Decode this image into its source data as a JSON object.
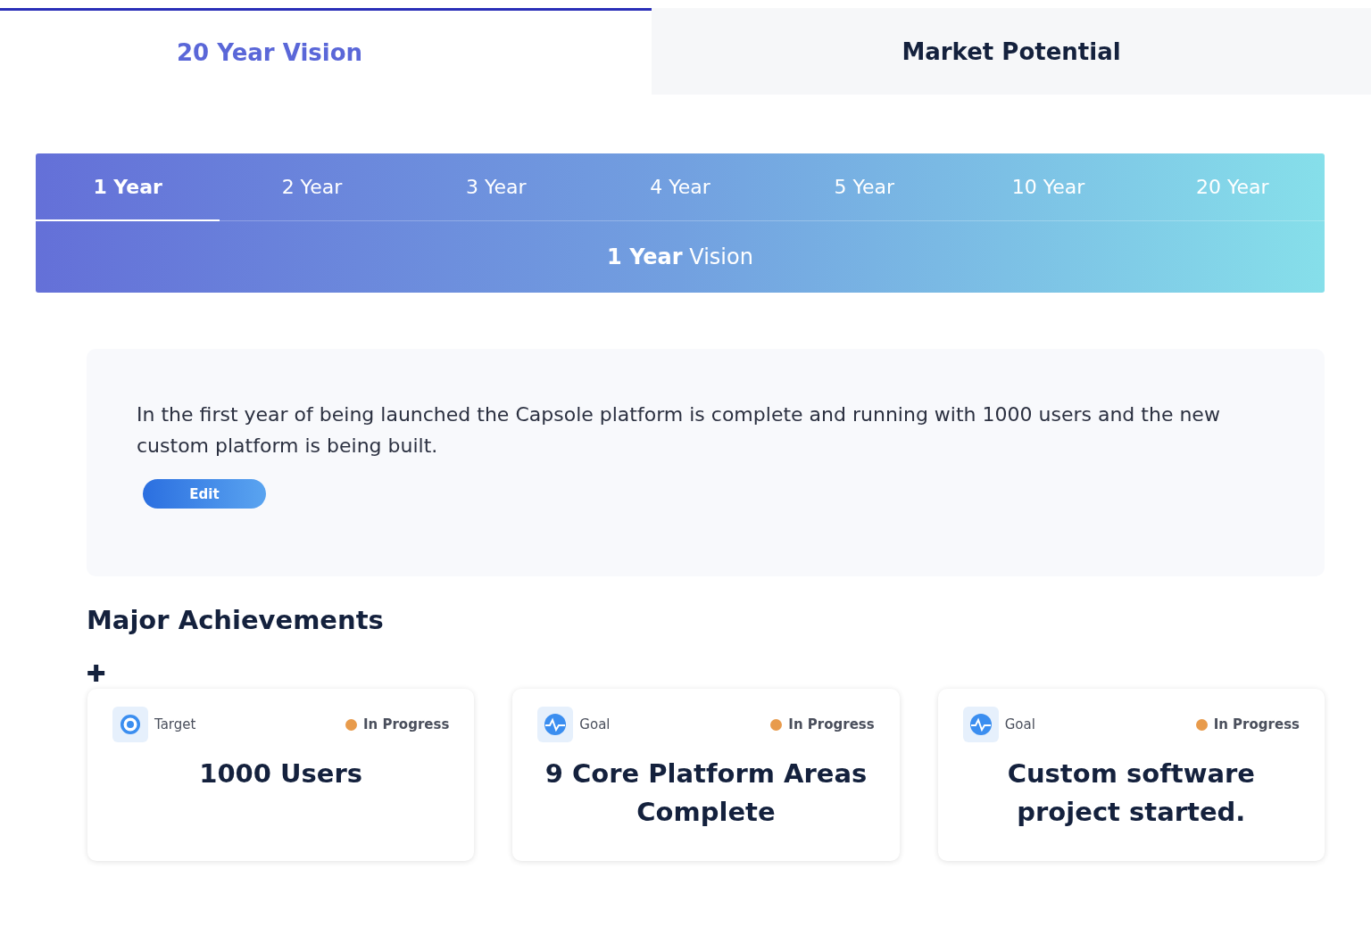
{
  "top_tabs": [
    {
      "label": "20 Year Vision",
      "selected": true
    },
    {
      "label": "Market Potential",
      "selected": false
    }
  ],
  "year_tabs": [
    {
      "label": "1 Year",
      "selected": true
    },
    {
      "label": "2 Year",
      "selected": false
    },
    {
      "label": "3 Year",
      "selected": false
    },
    {
      "label": "4 Year",
      "selected": false
    },
    {
      "label": "5 Year",
      "selected": false
    },
    {
      "label": "10 Year",
      "selected": false
    },
    {
      "label": "20 Year",
      "selected": false
    }
  ],
  "vision_title": "**1 Year** Vision",
  "vision": {
    "text": "In the first year of being launched the Capsole platform is complete and running with 1000 users and the new custom platform is being built.",
    "edit_button": "Edit"
  },
  "achievements": {
    "heading": "Major Achievements",
    "add_icon": "✚",
    "cards": [
      {
        "kind": "target",
        "type_label": "Target",
        "status": "In Progress",
        "color": "#e89b4c",
        "title": "1000 Users"
      },
      {
        "kind": "goal",
        "type_label": "Goal",
        "status": "In Progress",
        "color": "#e89b4c",
        "title": "9 Core Platform Areas Complete"
      },
      {
        "kind": "goal",
        "type_label": "Goal",
        "status": "In Progress",
        "color": "#e89b4c",
        "title": "Custom software project started."
      }
    ]
  }
}
